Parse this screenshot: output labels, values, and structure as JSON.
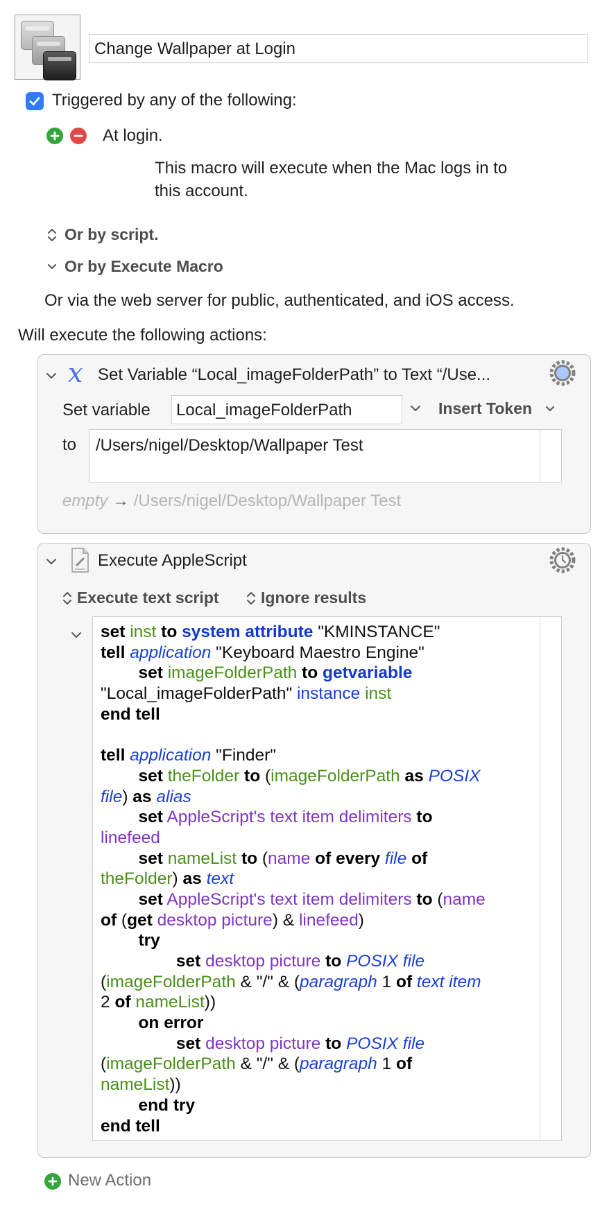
{
  "macro": {
    "name": "Change Wallpaper at Login",
    "icon": "windows-stack-icon"
  },
  "triggers": {
    "enabled": true,
    "header": "Triggered by any of the following:",
    "items": [
      {
        "label": "At login.",
        "description_lines": [
          "This macro will execute when the Mac logs in to",
          "this account."
        ]
      }
    ],
    "or_by_script": "Or by script.",
    "or_by_execute_macro": "Or by Execute Macro",
    "web_server_note": "Or via the web server for public, authenticated, and iOS access."
  },
  "actions_header": "Will execute the following actions:",
  "actions": [
    {
      "title": "Set Variable “Local_imageFolderPath” to Text “/Use...",
      "set_variable_label": "Set variable",
      "variable_name": "Local_imageFolderPath",
      "insert_token_label": "Insert Token",
      "to_label": "to",
      "text_value": "/Users/nigel/Desktop/Wallpaper Test",
      "preview_empty": "empty",
      "preview_arrow": "→",
      "preview_value": "/Users/nigel/Desktop/Wallpaper Test"
    },
    {
      "title": "Execute AppleScript",
      "mode_label": "Execute text script",
      "results_label": "Ignore results"
    }
  ],
  "script_lines": [
    [
      [
        "k",
        "set"
      ],
      [
        "t",
        " "
      ],
      [
        "v",
        "inst"
      ],
      [
        "t",
        " "
      ],
      [
        "k",
        "to"
      ],
      [
        "t",
        " "
      ],
      [
        "kb",
        "system attribute"
      ],
      [
        "t",
        " \"KMINSTANCE\""
      ]
    ],
    [
      [
        "k",
        "tell"
      ],
      [
        "t",
        " "
      ],
      [
        "c",
        "application"
      ],
      [
        "t",
        " \"Keyboard Maestro Engine\""
      ]
    ],
    [
      [
        "t",
        "        "
      ],
      [
        "k",
        "set"
      ],
      [
        "t",
        " "
      ],
      [
        "v",
        "imageFolderPath"
      ],
      [
        "t",
        " "
      ],
      [
        "k",
        "to"
      ],
      [
        "t",
        " "
      ],
      [
        "kb",
        "getvariable"
      ]
    ],
    [
      [
        "t",
        "\"Local_imageFolderPath\" "
      ],
      [
        "pl",
        "instance"
      ],
      [
        "t",
        " "
      ],
      [
        "v",
        "inst"
      ]
    ],
    [
      [
        "k",
        "end tell"
      ]
    ],
    [
      [
        "t",
        ""
      ]
    ],
    [
      [
        "k",
        "tell"
      ],
      [
        "t",
        " "
      ],
      [
        "c",
        "application"
      ],
      [
        "t",
        " \"Finder\""
      ]
    ],
    [
      [
        "t",
        "        "
      ],
      [
        "k",
        "set"
      ],
      [
        "t",
        " "
      ],
      [
        "v",
        "theFolder"
      ],
      [
        "t",
        " "
      ],
      [
        "k",
        "to"
      ],
      [
        "t",
        " ("
      ],
      [
        "v",
        "imageFolderPath"
      ],
      [
        "t",
        " "
      ],
      [
        "k",
        "as"
      ],
      [
        "t",
        " "
      ],
      [
        "c",
        "POSIX"
      ]
    ],
    [
      [
        "c",
        "file"
      ],
      [
        "t",
        ") "
      ],
      [
        "k",
        "as"
      ],
      [
        "t",
        " "
      ],
      [
        "c",
        "alias"
      ]
    ],
    [
      [
        "t",
        "        "
      ],
      [
        "k",
        "set"
      ],
      [
        "t",
        " "
      ],
      [
        "p",
        "AppleScript's text item delimiters"
      ],
      [
        "t",
        " "
      ],
      [
        "k",
        "to"
      ]
    ],
    [
      [
        "p",
        "linefeed"
      ]
    ],
    [
      [
        "t",
        "        "
      ],
      [
        "k",
        "set"
      ],
      [
        "t",
        " "
      ],
      [
        "v",
        "nameList"
      ],
      [
        "t",
        " "
      ],
      [
        "k",
        "to"
      ],
      [
        "t",
        " ("
      ],
      [
        "p",
        "name"
      ],
      [
        "t",
        " "
      ],
      [
        "k",
        "of every"
      ],
      [
        "t",
        " "
      ],
      [
        "c",
        "file"
      ],
      [
        "t",
        " "
      ],
      [
        "k",
        "of"
      ]
    ],
    [
      [
        "v",
        "theFolder"
      ],
      [
        "t",
        ") "
      ],
      [
        "k",
        "as"
      ],
      [
        "t",
        " "
      ],
      [
        "c",
        "text"
      ]
    ],
    [
      [
        "t",
        "        "
      ],
      [
        "k",
        "set"
      ],
      [
        "t",
        " "
      ],
      [
        "p",
        "AppleScript's text item delimiters"
      ],
      [
        "t",
        " "
      ],
      [
        "k",
        "to"
      ],
      [
        "t",
        " ("
      ],
      [
        "p",
        "name"
      ]
    ],
    [
      [
        "k",
        "of"
      ],
      [
        "t",
        " ("
      ],
      [
        "k",
        "get"
      ],
      [
        "t",
        " "
      ],
      [
        "p",
        "desktop picture"
      ],
      [
        "t",
        ") & "
      ],
      [
        "p",
        "linefeed"
      ],
      [
        "t",
        ")"
      ]
    ],
    [
      [
        "t",
        "        "
      ],
      [
        "k",
        "try"
      ]
    ],
    [
      [
        "t",
        "                "
      ],
      [
        "k",
        "set"
      ],
      [
        "t",
        " "
      ],
      [
        "p",
        "desktop picture"
      ],
      [
        "t",
        " "
      ],
      [
        "k",
        "to"
      ],
      [
        "t",
        " "
      ],
      [
        "c",
        "POSIX file"
      ]
    ],
    [
      [
        "t",
        "("
      ],
      [
        "v",
        "imageFolderPath"
      ],
      [
        "t",
        " & \"/\" & ("
      ],
      [
        "c",
        "paragraph"
      ],
      [
        "t",
        " 1 "
      ],
      [
        "k",
        "of"
      ],
      [
        "t",
        " "
      ],
      [
        "c",
        "text item"
      ]
    ],
    [
      [
        "t",
        "2 "
      ],
      [
        "k",
        "of"
      ],
      [
        "t",
        " "
      ],
      [
        "v",
        "nameList"
      ],
      [
        "t",
        "))"
      ]
    ],
    [
      [
        "t",
        "        "
      ],
      [
        "k",
        "on error"
      ]
    ],
    [
      [
        "t",
        "                "
      ],
      [
        "k",
        "set"
      ],
      [
        "t",
        " "
      ],
      [
        "p",
        "desktop picture"
      ],
      [
        "t",
        " "
      ],
      [
        "k",
        "to"
      ],
      [
        "t",
        " "
      ],
      [
        "c",
        "POSIX file"
      ]
    ],
    [
      [
        "t",
        "("
      ],
      [
        "v",
        "imageFolderPath"
      ],
      [
        "t",
        " & \"/\" & ("
      ],
      [
        "c",
        "paragraph"
      ],
      [
        "t",
        " 1 "
      ],
      [
        "k",
        "of"
      ]
    ],
    [
      [
        "v",
        "nameList"
      ],
      [
        "t",
        "))"
      ]
    ],
    [
      [
        "t",
        "        "
      ],
      [
        "k",
        "end try"
      ]
    ],
    [
      [
        "k",
        "end tell"
      ]
    ]
  ],
  "new_action_label": "New Action"
}
